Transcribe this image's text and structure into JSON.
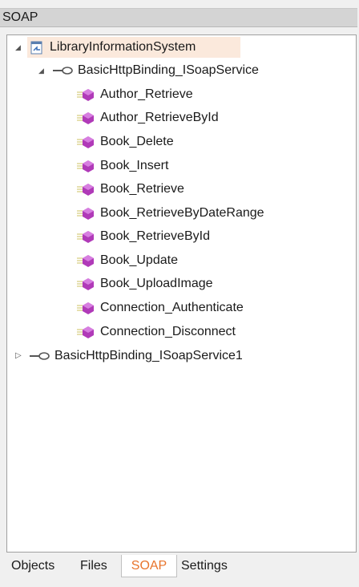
{
  "panel": {
    "title": "SOAP"
  },
  "tree": {
    "root": {
      "label": "LibraryInformationSystem",
      "icon": "service-reference-icon",
      "expanded": true
    },
    "bindings": [
      {
        "label": "BasicHttpBinding_ISoapService",
        "icon": "binding-endpoint-icon",
        "expanded": true,
        "operations": [
          "Author_Retrieve",
          "Author_RetrieveById",
          "Book_Delete",
          "Book_Insert",
          "Book_Retrieve",
          "Book_RetrieveByDateRange",
          "Book_RetrieveById",
          "Book_Update",
          "Book_UploadImage",
          "Connection_Authenticate",
          "Connection_Disconnect"
        ]
      },
      {
        "label": "BasicHttpBinding_ISoapService1",
        "icon": "binding-endpoint-icon",
        "expanded": false,
        "operations": []
      }
    ]
  },
  "tabs": [
    {
      "label": "Objects",
      "active": false
    },
    {
      "label": "Files",
      "active": false
    },
    {
      "label": "SOAP",
      "active": true
    },
    {
      "label": "Settings",
      "active": false
    }
  ],
  "colors": {
    "accent": "#e8742c",
    "selection": "#fbe9dc",
    "method_icon": "#b03ab8"
  }
}
